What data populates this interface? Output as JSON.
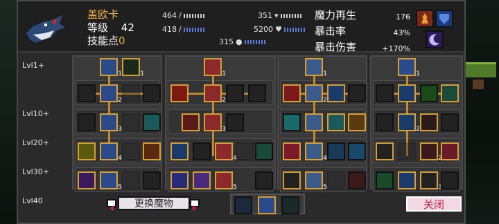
{
  "header": {
    "name": "盖欧卡",
    "level_label": "等级",
    "level_value": "42",
    "skill_points_label": "技能点",
    "skill_points_value": "0",
    "stats": {
      "attack": "464",
      "defense": "351",
      "crit": "418",
      "health": "5200",
      "speed": "315"
    },
    "right_stats": [
      {
        "label": "魔力再生",
        "value": "176"
      },
      {
        "label": "暴击率",
        "value": "43%"
      },
      {
        "label": "暴击伤害",
        "value": "+170%"
      }
    ]
  },
  "levels": [
    "Lvl1+",
    "Lvl10+",
    "Lvl20+",
    "Lvl30+",
    "Lvl40"
  ],
  "trees": [
    {
      "name": "tree-1",
      "top_count": "1"
    },
    {
      "name": "tree-2",
      "top_count": "1"
    },
    {
      "name": "tree-3",
      "top_count": "1"
    },
    {
      "name": "tree-4",
      "top_count": "1"
    }
  ],
  "counts": {
    "t1r1": "1",
    "t1r1b": "2",
    "t1r2": "3",
    "t1r3": "4",
    "t1r4": "5",
    "t2r1": "2",
    "t2r2": "3",
    "t2r3": "4",
    "t2r4": "5",
    "t3r1": "2",
    "t3r3": "4",
    "t3r4": "5",
    "t4r2": "2",
    "t4r3": "2",
    "t4r4": "3"
  },
  "footer": {
    "switch_label": "更换魔物",
    "close_label": "关闭"
  },
  "colors": {
    "accent_gold": "#f0b040",
    "close_text": "#c02040"
  }
}
